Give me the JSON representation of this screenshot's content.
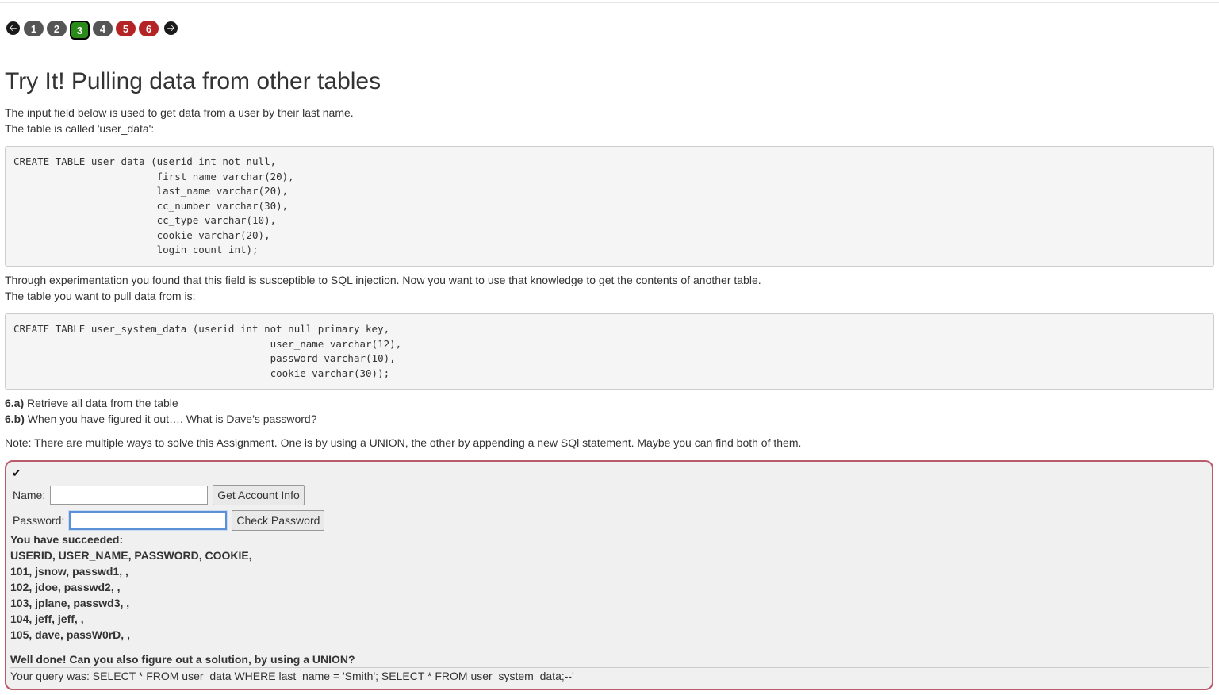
{
  "pager": {
    "prev_icon": "arrow-left-icon",
    "next_icon": "arrow-right-icon",
    "pages": [
      {
        "label": "1",
        "state": "grey"
      },
      {
        "label": "2",
        "state": "grey"
      },
      {
        "label": "3",
        "state": "current"
      },
      {
        "label": "4",
        "state": "grey"
      },
      {
        "label": "5",
        "state": "red"
      },
      {
        "label": "6",
        "state": "red"
      }
    ]
  },
  "title": "Try It! Pulling data from other tables",
  "intro": {
    "line1": "The input field below is used to get data from a user by their last name.",
    "line2": "The table is called 'user_data':"
  },
  "code1": "CREATE TABLE user_data (userid int not null,\n                        first_name varchar(20),\n                        last_name varchar(20),\n                        cc_number varchar(30),\n                        cc_type varchar(10),\n                        cookie varchar(20),\n                        login_count int);",
  "middle": {
    "line1": "Through experimentation you found that this field is susceptible to SQL injection. Now you want to use that knowledge to get the contents of another table.",
    "line2": "The table you want to pull data from is:"
  },
  "code2": "CREATE TABLE user_system_data (userid int not null primary key,\n                                           user_name varchar(12),\n                                           password varchar(10),\n                                           cookie varchar(30));",
  "tasks": {
    "a_label": "6.a)",
    "a_text": " Retrieve all data from the table",
    "b_label": "6.b)",
    "b_text": " When you have figured it out…. What is Dave’s password?"
  },
  "note": "Note: There are multiple ways to solve this Assignment. One is by using a UNION, the other by appending a new SQl statement. Maybe you can find both of them.",
  "form": {
    "check_icon": "checkmark-icon",
    "name_label": "Name:",
    "name_value": "",
    "get_button": "Get Account Info",
    "password_label": "Password:",
    "password_value": "",
    "check_button": "Check Password"
  },
  "results": {
    "heading": "You have succeeded:",
    "columns": "USERID, USER_NAME, PASSWORD, COOKIE,",
    "rows": [
      "101, jsnow, passwd1, ,",
      "102, jdoe, passwd2, ,",
      "103, jplane, passwd3, ,",
      "104, jeff, jeff, ,",
      "105, dave, passW0rD, ,"
    ],
    "feedback": "Well done! Can you also figure out a solution, by using a UNION?",
    "query": "Your query was: SELECT * FROM user_data WHERE last_name = 'Smith'; SELECT * FROM user_system_data;--'"
  },
  "colors": {
    "page_grey": "#555555",
    "page_red": "#b52424",
    "page_current": "#2a8a1a",
    "attack_border": "#b95b6b"
  }
}
